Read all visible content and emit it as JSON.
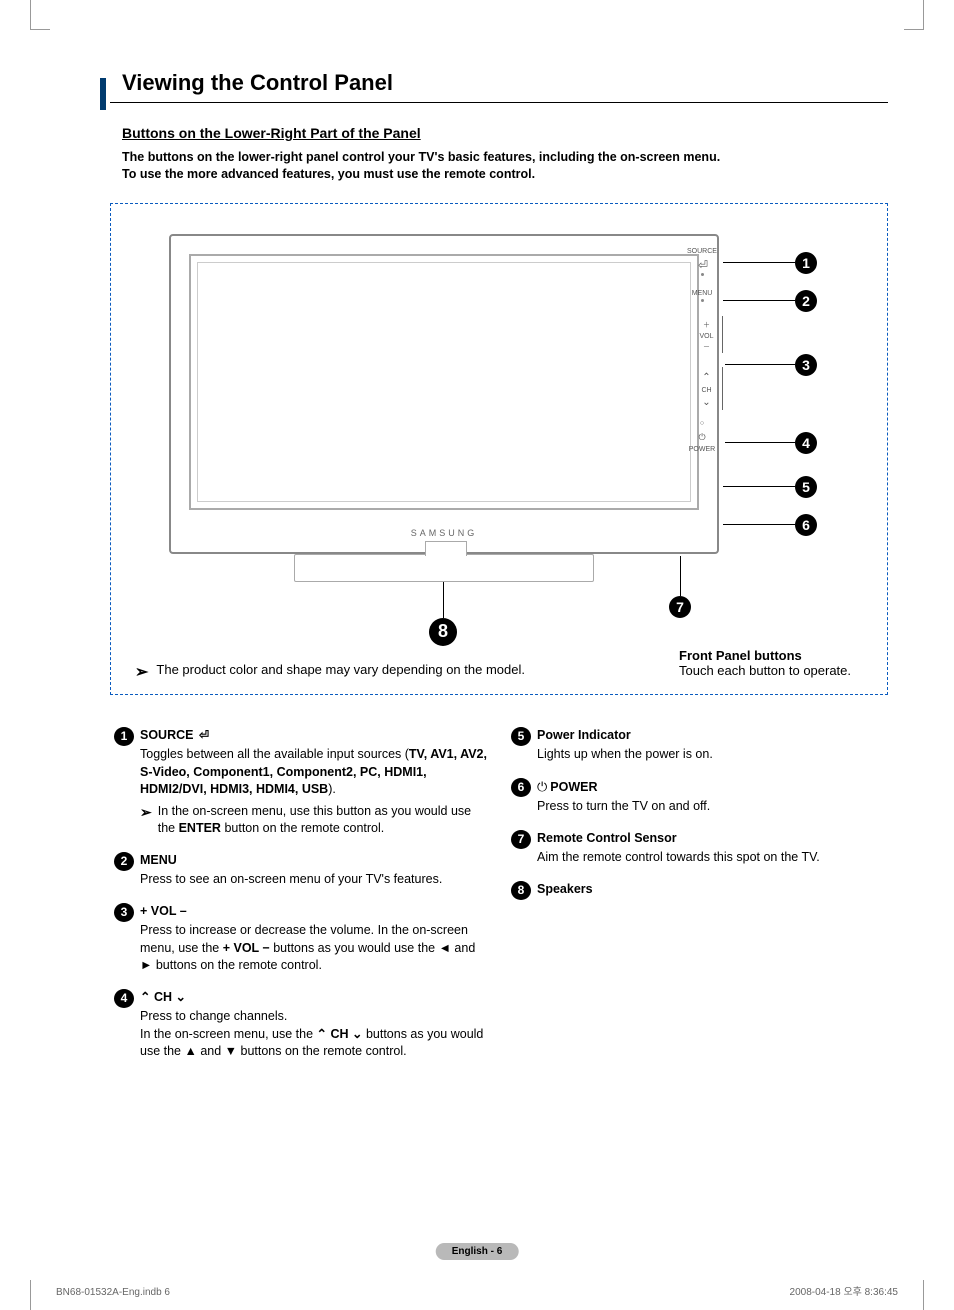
{
  "heading": "Viewing the Control Panel",
  "subheading": "Buttons on the Lower-Right Part of the Panel",
  "intro_line1": "The buttons on the lower-right panel control your TV's basic features, including the on-screen menu.",
  "intro_line2": "To use the more advanced features, you must use the remote control.",
  "brand": "SAMSUNG",
  "side_labels": {
    "source": "SOURCE",
    "menu": "MENU",
    "vol": "VOL",
    "ch": "CH",
    "power": "POWER"
  },
  "callouts": [
    "1",
    "2",
    "3",
    "4",
    "5",
    "6",
    "7",
    "8"
  ],
  "diagram_note": "The product color and shape may vary depending on the model.",
  "front_panel": {
    "title": "Front Panel buttons",
    "text": "Touch each button to operate."
  },
  "left_items": [
    {
      "n": "1",
      "title": "SOURCE ",
      "text1": "Toggles between all the available input sources (",
      "sources": "TV, AV1, AV2, S-Video, Component1, Component2, PC, HDMI1, HDMI2/DVI, HDMI3, HDMI4, USB",
      "text2": ").",
      "sub_a": "In the on-screen menu, use this button as you would use the ",
      "sub_b": "ENTER",
      "sub_c": " button on the remote control."
    },
    {
      "n": "2",
      "title": "MENU",
      "text": "Press to see an on-screen menu of your TV's features."
    },
    {
      "n": "3",
      "title": "+ VOL –",
      "text_a": "Press to increase or decrease the volume. In the on-screen menu, use the ",
      "text_b": "+ VOL −",
      "text_c": " buttons as you would use the ◄ and ► buttons on the remote control."
    },
    {
      "n": "4",
      "title_pre": "⌃",
      "title_mid": " CH ",
      "title_post": "⌄",
      "text_a": "Press to change channels.",
      "text_b": "In the on-screen menu, use the ",
      "text_c": " CH ",
      "text_d": " buttons as you would use the ▲ and ▼ buttons on the remote control."
    }
  ],
  "right_items": [
    {
      "n": "5",
      "title": "Power Indicator",
      "text": "Lights up when the power is on."
    },
    {
      "n": "6",
      "title": "POWER",
      "text": "Press to turn the TV on and off.",
      "power_icon": true
    },
    {
      "n": "7",
      "title": "Remote Control Sensor",
      "text": "Aim the remote control towards this spot on the TV."
    },
    {
      "n": "8",
      "title": "Speakers",
      "text": ""
    }
  ],
  "page_badge": "English - 6",
  "footer_left": "BN68-01532A-Eng.indb   6",
  "footer_right": "2008-04-18   오후 8:36:45"
}
